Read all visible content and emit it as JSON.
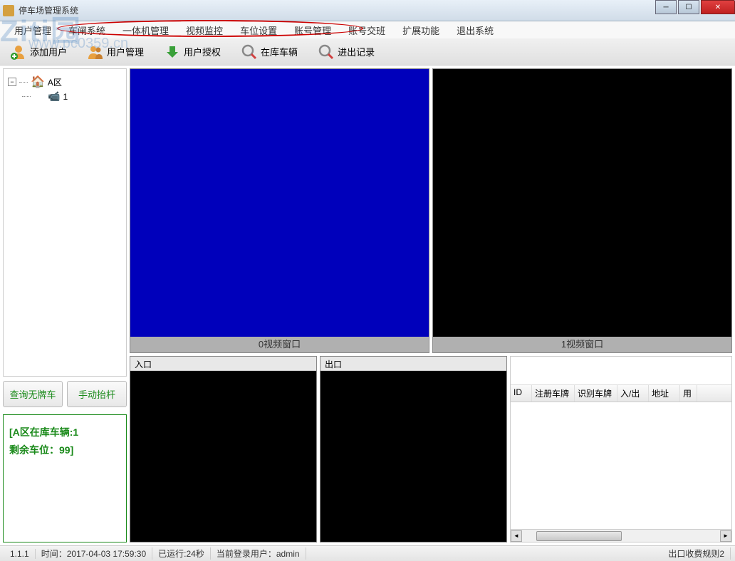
{
  "window": {
    "title": "停车场管理系统"
  },
  "watermark": {
    "text": "Ziti园",
    "url": "www.pc0359.cn"
  },
  "menu": {
    "items": [
      "用户管理",
      "车闸系统",
      "一体机管理",
      "视频监控",
      "车位设置",
      "账号管理",
      "账号交班",
      "扩展功能",
      "退出系统"
    ]
  },
  "toolbar": {
    "add_user": "添加用户",
    "user_mgmt": "用户管理",
    "user_auth": "用户授权",
    "in_garage": "在库车辆",
    "inout_log": "进出记录"
  },
  "tree": {
    "root": "A区",
    "child": "1"
  },
  "side_buttons": {
    "query_noplate": "查询无牌车",
    "manual_lift": "手动抬杆"
  },
  "info": {
    "line1": "[A区在库车辆:1",
    "line2": "剩余车位：99]"
  },
  "video": {
    "window0": "0视频窗口",
    "window1": "1视频窗口",
    "entry": "入口",
    "exit": "出口"
  },
  "table": {
    "columns": [
      "ID",
      "注册车牌",
      "识别车牌",
      "入/出",
      "地址",
      "用"
    ]
  },
  "status": {
    "version": "1.1.1",
    "time_label": "时间：",
    "time_value": "2017-04-03 17:59:30",
    "runtime_label": "已运行:",
    "runtime_value": "24秒",
    "user_label": "当前登录用户：",
    "user_value": "admin",
    "rule": "出口收费规则2"
  }
}
